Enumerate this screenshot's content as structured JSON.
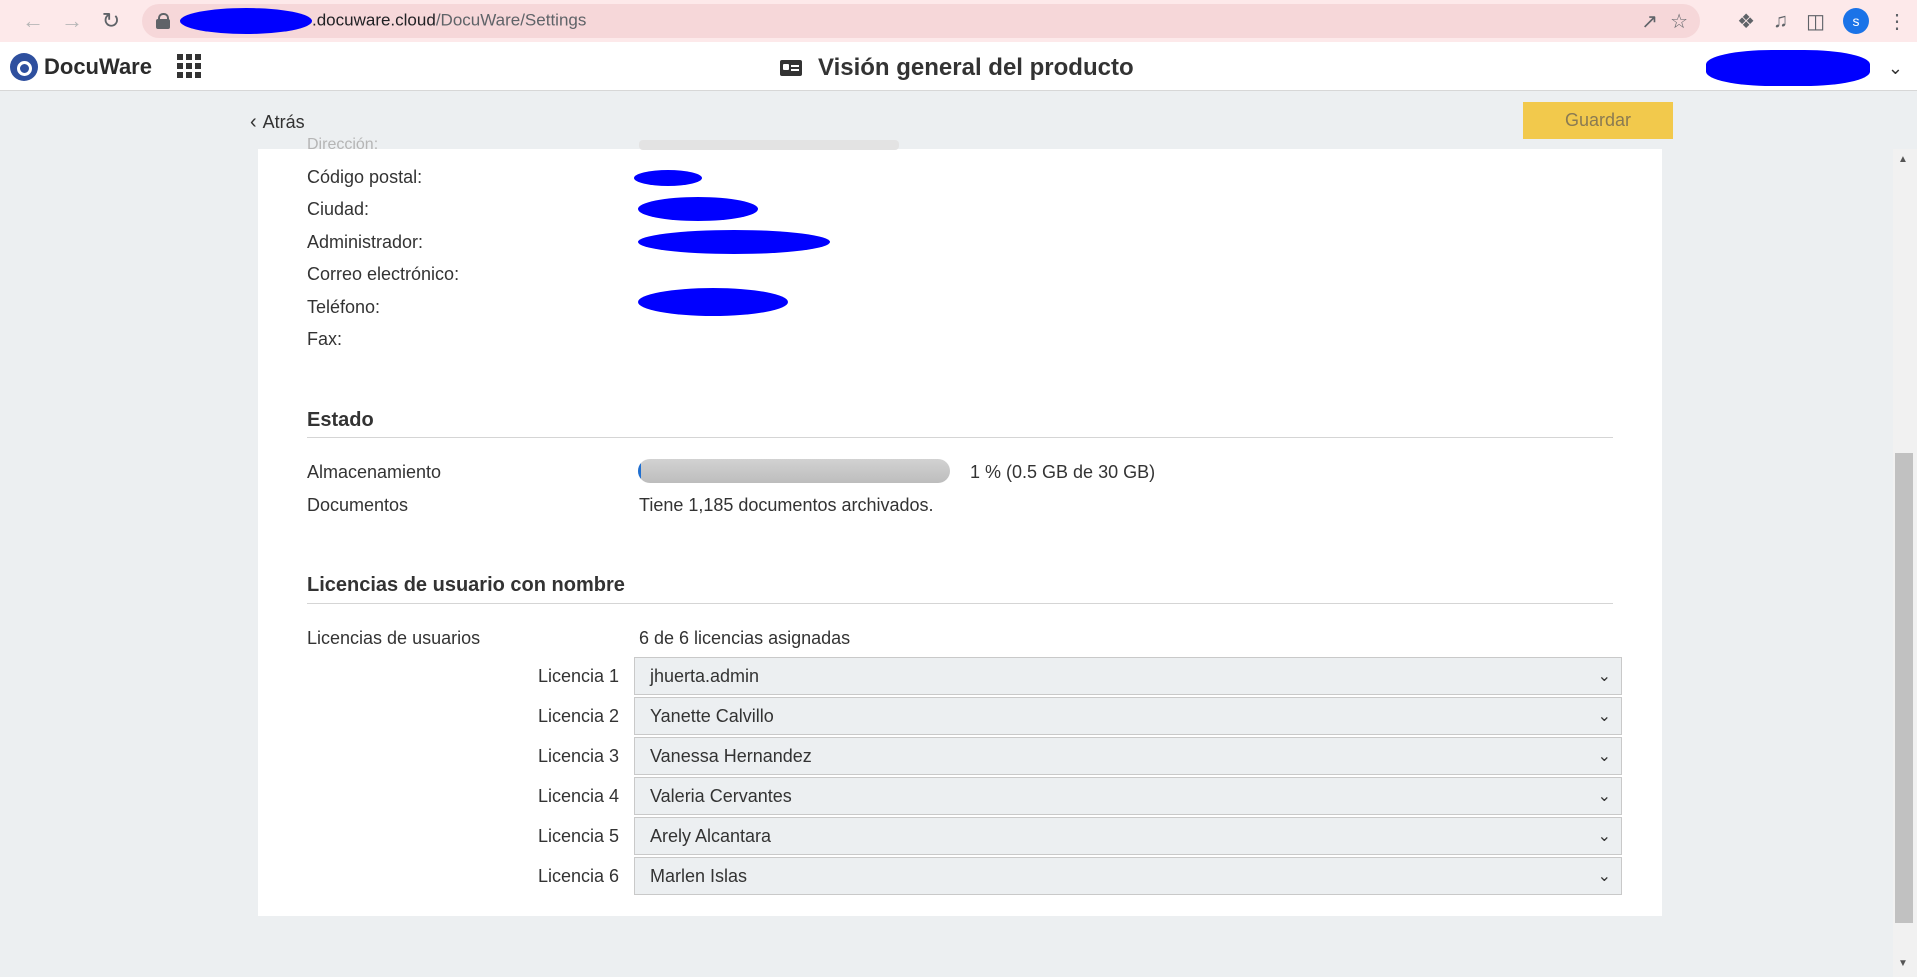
{
  "browser": {
    "url_host": ".docuware.cloud",
    "url_path": "/DocuWare/Settings",
    "profile_initial": "s"
  },
  "app": {
    "logo_text": "DocuWare",
    "page_title": "Visión general del producto"
  },
  "toolbar": {
    "back_label": "Atrás",
    "save_label": "Guardar"
  },
  "info": {
    "direccion_label": "Dirección:",
    "postal_label": "Código postal:",
    "city_label": "Ciudad:",
    "admin_label": "Administrador:",
    "email_label": "Correo electrónico:",
    "phone_label": "Teléfono:",
    "fax_label": "Fax:"
  },
  "status": {
    "title": "Estado",
    "storage_label": "Almacenamiento",
    "storage_text": "1 % (0.5 GB de 30 GB)",
    "storage_fraction": 0.01,
    "documents_label": "Documentos",
    "documents_text": "Tiene 1,185 documentos archivados."
  },
  "licenses": {
    "title": "Licencias de usuario con nombre",
    "users_label": "Licencias de usuarios",
    "users_value": "6 de 6 licencias asignadas",
    "items": [
      {
        "label": "Licencia 1",
        "value": "jhuerta.admin"
      },
      {
        "label": "Licencia 2",
        "value": "Yanette Calvillo"
      },
      {
        "label": "Licencia 3",
        "value": "Vanessa Hernandez"
      },
      {
        "label": "Licencia 4",
        "value": "Valeria Cervantes"
      },
      {
        "label": "Licencia 5",
        "value": "Arely Alcantara"
      },
      {
        "label": "Licencia 6",
        "value": "Marlen Islas"
      }
    ]
  },
  "colors": {
    "accent_save": "#f2c94c",
    "storage_fill": "#1f6fd1",
    "redaction": "#0000ff"
  }
}
